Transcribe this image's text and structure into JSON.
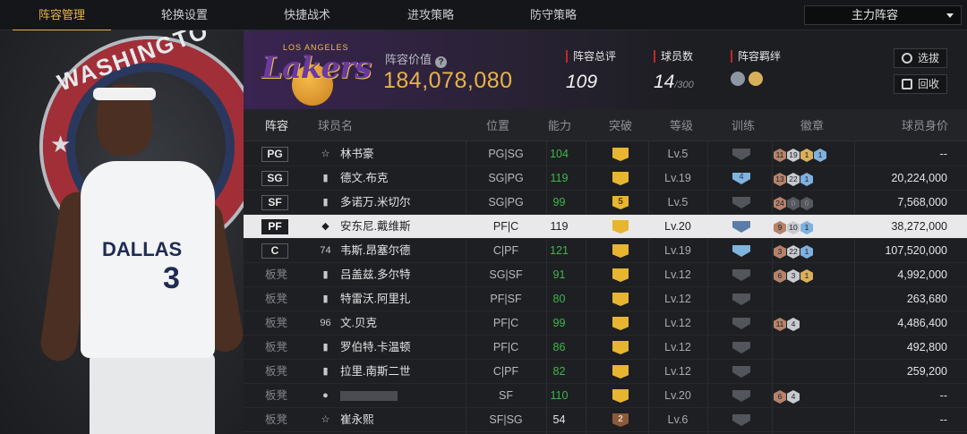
{
  "tabs": [
    {
      "label": "阵容管理",
      "active": true
    },
    {
      "label": "轮换设置",
      "active": false
    },
    {
      "label": "快捷战术",
      "active": false
    },
    {
      "label": "进攻策略",
      "active": false
    },
    {
      "label": "防守策略",
      "active": false
    }
  ],
  "lineup_select": {
    "value": "主力阵容",
    "icon": "chevron-down-icon"
  },
  "portrait": {
    "ring_text": "WASHINGTO",
    "jersey_team": "DALLAS",
    "jersey_number": "3"
  },
  "team": {
    "logo_word": "Lakers",
    "logo_top": "LOS ANGELES",
    "value_label": "阵容价值",
    "value": "184,078,080",
    "stats": [
      {
        "label": "阵容总评",
        "value": "109",
        "suffix": ""
      },
      {
        "label": "球员数",
        "value": "14",
        "suffix": "/300"
      },
      {
        "label": "阵容羁绊",
        "value": "",
        "suffix": ""
      }
    ],
    "buttons": {
      "select": "选拔",
      "recycle": "回收"
    },
    "accent": "#e8b24a",
    "purple": "#6a3aa0"
  },
  "table": {
    "headers": [
      "阵容",
      "球员名",
      "位置",
      "能力",
      "突破",
      "等级",
      "训练",
      "徽章",
      "球员身价"
    ],
    "rows": [
      {
        "slot": "PG",
        "bench": false,
        "icon": "☆",
        "name": "林书豪",
        "pos": "PG|SG",
        "rating": "104",
        "green": true,
        "brk": "",
        "brk_brown": false,
        "level": "Lv.5",
        "train": "",
        "train_blue": false,
        "badges": [
          [
            "11",
            "b"
          ],
          [
            "19",
            "s"
          ],
          [
            "1",
            "g"
          ],
          [
            "1",
            "h"
          ]
        ],
        "salary": "--"
      },
      {
        "slot": "SG",
        "bench": false,
        "icon": "▮",
        "name": "德文.布克",
        "pos": "SG|PG",
        "rating": "119",
        "green": true,
        "brk": "",
        "brk_brown": false,
        "level": "Lv.19",
        "train": "4",
        "train_blue": true,
        "badges": [
          [
            "13",
            "b"
          ],
          [
            "22",
            "s"
          ],
          [
            "1",
            "h"
          ]
        ],
        "salary": "20,224,000"
      },
      {
        "slot": "SF",
        "bench": false,
        "icon": "▮",
        "name": "多诺万.米切尔",
        "pos": "SG|PG",
        "rating": "99",
        "green": true,
        "brk": "5",
        "brk_brown": false,
        "level": "Lv.5",
        "train": "",
        "train_blue": false,
        "badges": [
          [
            "24",
            "b"
          ],
          [
            "0",
            "d"
          ],
          [
            "0",
            "d"
          ]
        ],
        "salary": "7,568,000"
      },
      {
        "slot": "PF",
        "bench": false,
        "icon": "◆",
        "name": "安东尼.戴维斯",
        "pos": "PF|C",
        "rating": "119",
        "green": false,
        "brk": "",
        "brk_brown": false,
        "level": "Lv.20",
        "train": "",
        "train_blue": true,
        "badges": [
          [
            "9",
            "b"
          ],
          [
            "10",
            "s"
          ],
          [
            "1",
            "h"
          ]
        ],
        "salary": "38,272,000"
      },
      {
        "slot": "C",
        "bench": false,
        "icon": "74",
        "name": "韦斯.昂塞尔德",
        "pos": "C|PF",
        "rating": "121",
        "green": true,
        "brk": "",
        "brk_brown": false,
        "level": "Lv.19",
        "train": "",
        "train_blue": true,
        "badges": [
          [
            "3",
            "b"
          ],
          [
            "22",
            "s"
          ],
          [
            "1",
            "h"
          ]
        ],
        "salary": "107,520,000"
      },
      {
        "slot": "板凳",
        "bench": true,
        "icon": "▮",
        "name": "吕盖兹.多尔特",
        "pos": "SG|SF",
        "rating": "91",
        "green": true,
        "brk": "",
        "brk_brown": false,
        "level": "Lv.12",
        "train": "",
        "train_blue": false,
        "badges": [
          [
            "6",
            "b"
          ],
          [
            "3",
            "s"
          ],
          [
            "1",
            "g"
          ]
        ],
        "salary": "4,992,000"
      },
      {
        "slot": "板凳",
        "bench": true,
        "icon": "▮",
        "name": "特雷沃.阿里扎",
        "pos": "PF|SF",
        "rating": "80",
        "green": true,
        "brk": "",
        "brk_brown": false,
        "level": "Lv.12",
        "train": "",
        "train_blue": false,
        "badges": [],
        "salary": "263,680"
      },
      {
        "slot": "板凳",
        "bench": true,
        "icon": "96",
        "name": "文.贝克",
        "pos": "PF|C",
        "rating": "99",
        "green": true,
        "brk": "",
        "brk_brown": false,
        "level": "Lv.12",
        "train": "",
        "train_blue": false,
        "badges": [
          [
            "11",
            "b"
          ],
          [
            "4",
            "s"
          ]
        ],
        "salary": "4,486,400"
      },
      {
        "slot": "板凳",
        "bench": true,
        "icon": "▮",
        "name": "罗伯特.卡温顿",
        "pos": "PF|C",
        "rating": "86",
        "green": true,
        "brk": "",
        "brk_brown": false,
        "level": "Lv.12",
        "train": "",
        "train_blue": false,
        "badges": [],
        "salary": "492,800"
      },
      {
        "slot": "板凳",
        "bench": true,
        "icon": "▮",
        "name": "拉里.南斯二世",
        "pos": "C|PF",
        "rating": "82",
        "green": true,
        "brk": "",
        "brk_brown": false,
        "level": "Lv.12",
        "train": "",
        "train_blue": false,
        "badges": [],
        "salary": "259,200"
      },
      {
        "slot": "板凳",
        "bench": true,
        "icon": "●",
        "name": "",
        "pos": "SF",
        "rating": "110",
        "green": true,
        "brk": "",
        "brk_brown": false,
        "level": "Lv.20",
        "train": "",
        "train_blue": false,
        "badges": [
          [
            "6",
            "b"
          ],
          [
            "4",
            "s"
          ]
        ],
        "salary": "--"
      },
      {
        "slot": "板凳",
        "bench": true,
        "icon": "☆",
        "name": "崔永熙",
        "pos": "SF|SG",
        "rating": "54",
        "green": false,
        "brk": "2",
        "brk_brown": true,
        "level": "Lv.6",
        "train": "",
        "train_blue": false,
        "badges": [],
        "salary": "--"
      }
    ],
    "selected_index": 3
  }
}
